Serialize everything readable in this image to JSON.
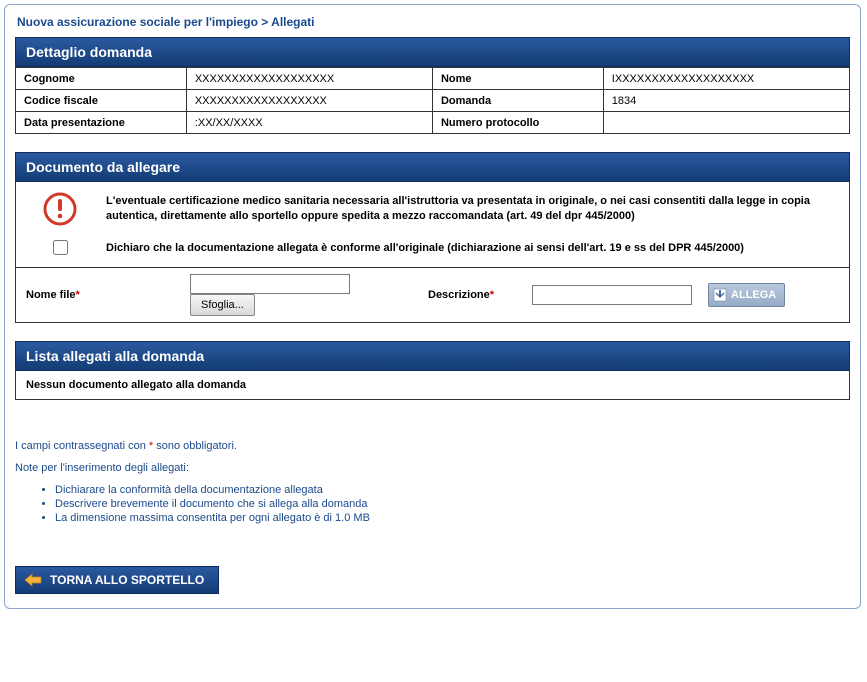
{
  "breadcrumb": {
    "root": "Nuova assicurazione sociale per l'impiego",
    "sep": " > ",
    "current": "Allegati"
  },
  "sections": {
    "detail_title": "Dettaglio domanda",
    "attach_title": "Documento da allegare",
    "list_title": "Lista allegati alla domanda"
  },
  "detail": {
    "labels": {
      "cognome": "Cognome",
      "nome": "Nome",
      "codice_fiscale": "Codice fiscale",
      "domanda": "Domanda",
      "data_presentazione": "Data presentazione",
      "numero_protocollo": "Numero protocollo"
    },
    "values": {
      "cognome": "XXXXXXXXXXXXXXXXXXX",
      "nome": "IXXXXXXXXXXXXXXXXXXX",
      "codice_fiscale": "XXXXXXXXXXXXXXXXXX",
      "domanda": "1834",
      "data_presentazione": ":XX/XX/XXXX",
      "numero_protocollo": ""
    }
  },
  "attach": {
    "warning_text": "L'eventuale certificazione medico sanitaria necessaria all'istruttoria va presentata in originale, o nei casi consentiti dalla legge in copia autentica, direttamente allo sportello oppure spedita a mezzo raccomandata (art. 49 del dpr 445/2000)",
    "declare_text": "Dichiaro che la documentazione allegata è conforme all'originale (dichiarazione ai sensi dell'art. 19 e ss del DPR 445/2000)",
    "file_label": "Nome file",
    "browse_label": "Sfoglia...",
    "desc_label": "Descrizione",
    "allega_label": "ALLEGA"
  },
  "list": {
    "empty_text": "Nessun documento allegato alla domanda"
  },
  "notes": {
    "mandatory_prefix": "I campi contrassegnati con ",
    "mandatory_suffix": " sono obbligatori.",
    "title": "Note per l'inserimento degli allegati:",
    "items": [
      "Dichiarare la conformità della documentazione allegata",
      "Descrivere brevemente il documento che si allega alla domanda",
      "La dimensione massima consentita per ogni allegato è di 1.0 MB"
    ]
  },
  "back_label": "TORNA ALLO SPORTELLO"
}
